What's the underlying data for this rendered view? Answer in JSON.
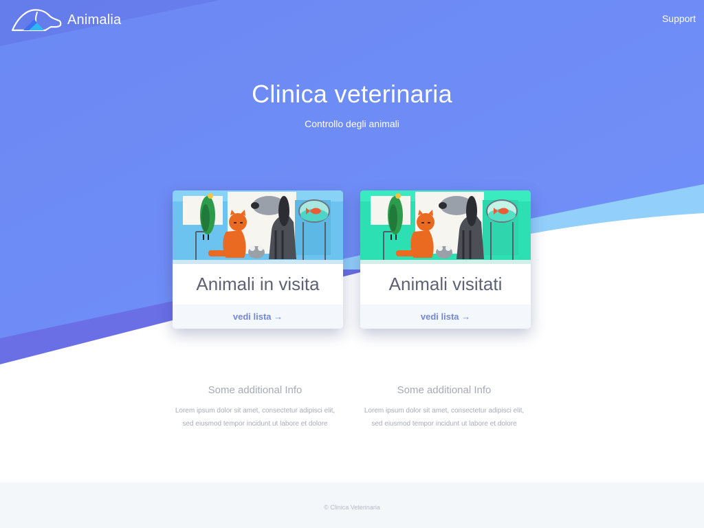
{
  "navbar": {
    "brand_name": "Animalia",
    "logo_icon": "dog-silhouette-logo-icon",
    "support_label": "Support"
  },
  "hero": {
    "title": "Clinica veterinaria",
    "subtitle": "Controllo degli animali"
  },
  "cards": [
    {
      "title": "Animali in visita",
      "link_label": "vedi lista →",
      "image": "pets-illustration-blue",
      "image_bg": "#6cc3f0"
    },
    {
      "title": "Animali visitati",
      "link_label": "vedi lista →",
      "image": "pets-illustration-green",
      "image_bg": "#2de0b3"
    }
  ],
  "info": [
    {
      "title": "Some additional Info",
      "text_line1": "Lorem ipsum dolor sit amet, consectetur adipisci elit,",
      "text_line2": "sed eiusmod tempor incidunt ut labore et dolore"
    },
    {
      "title": "Some additional Info",
      "text_line1": "Lorem ipsum dolor sit amet, consectetur adipisci elit,",
      "text_line2": "sed eiusmod tempor incidunt ut labore et dolore"
    }
  ],
  "footer": {
    "text": "© Clinica Veterinaria"
  },
  "colors": {
    "hero_blue": "#6b8af5",
    "hero_purple": "#6d6fe6",
    "wave_light_blue": "#92cdfb",
    "link_color": "#7387d6",
    "footer_bg": "#f4f7fa"
  }
}
